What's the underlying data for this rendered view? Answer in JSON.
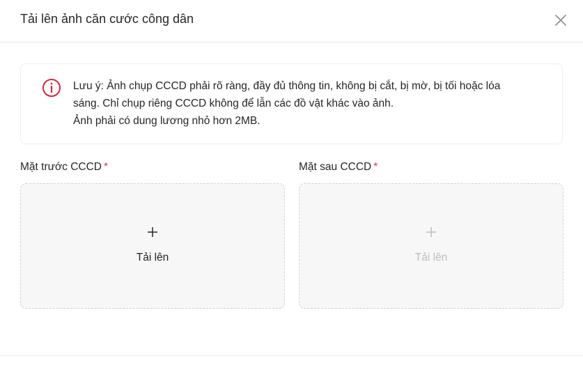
{
  "modal": {
    "title": "Tải lên ảnh căn cước công dân"
  },
  "notice": {
    "icon": "info-circle-icon",
    "lines": [
      "Lưu ý: Ảnh chụp CCCD phải rõ ràng, đầy đủ thông tin, không bị cắt, bị mờ, bị tối hoặc lóa",
      "sáng. Chỉ chụp riêng CCCD không để lẫn các đồ vật khác vào ảnh.",
      "Ảnh phải có dung lương nhỏ hơn 2MB."
    ]
  },
  "front": {
    "label": "Mặt trước CCCD",
    "required_mark": "*",
    "upload_label": "Tải lên"
  },
  "back": {
    "label": "Mặt sau CCCD",
    "required_mark": "*",
    "upload_label": "Tải lên"
  },
  "colors": {
    "accent_red": "#d0293b",
    "required": "#e03a3a",
    "disabled_text": "#bdbdbd"
  }
}
